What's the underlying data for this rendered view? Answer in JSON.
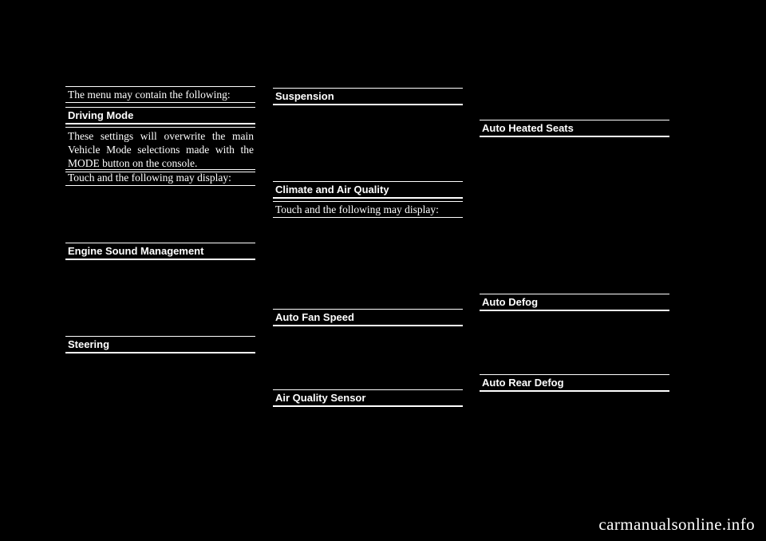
{
  "page": {
    "background_color": "#000000",
    "text_color": "#ffffff",
    "footer": "carmanualsonline.info"
  },
  "column_left": {
    "intro": "The menu may contain the following:",
    "heading_driving_mode": "Driving Mode",
    "paragraph_driving_mode": "These settings will overwrite the main Vehicle Mode selections made with the MODE button on the console.",
    "touch_note": "Touch and the following may display:",
    "heading_engine_sound_management": "Engine Sound Management",
    "heading_steering": "Steering"
  },
  "column_middle": {
    "heading_suspension": "Suspension",
    "heading_climate_and_air_quality": "Climate and Air Quality",
    "touch_note": "Touch and the following may display:",
    "heading_auto_fan_speed": "Auto Fan Speed",
    "heading_air_quality_sensor": "Air Quality Sensor"
  },
  "column_right": {
    "heading_auto_heated_seats": "Auto Heated Seats",
    "heading_auto_defog": "Auto Defog",
    "heading_auto_rear_defog": "Auto Rear Defog"
  }
}
